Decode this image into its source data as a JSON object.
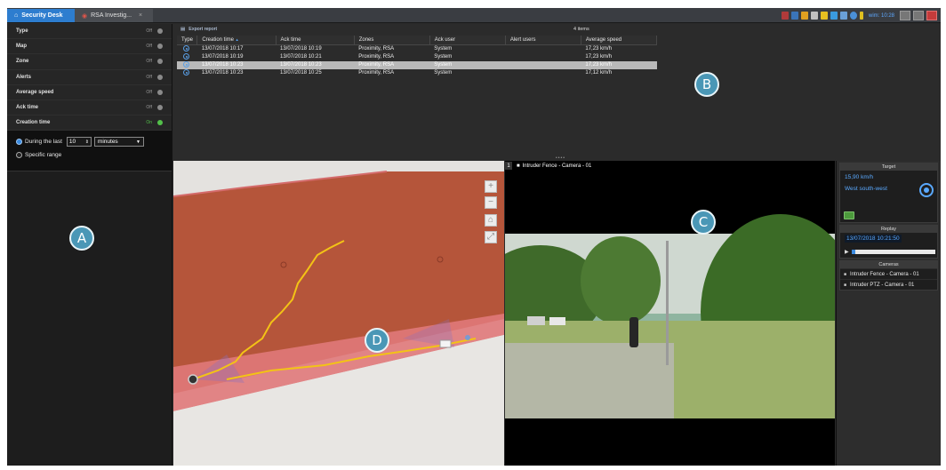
{
  "tabs": [
    {
      "label": "Security Desk",
      "icon": "home-icon"
    },
    {
      "label": "RSA Investig...",
      "icon": "rsa-icon",
      "close": "×"
    }
  ],
  "tray": {
    "clock": "wim: 10:28"
  },
  "filters": [
    {
      "label": "Type",
      "state": "Off"
    },
    {
      "label": "Map",
      "state": "Off"
    },
    {
      "label": "Zone",
      "state": "Off"
    },
    {
      "label": "Alerts",
      "state": "Off"
    },
    {
      "label": "Average speed",
      "state": "Off"
    },
    {
      "label": "Ack time",
      "state": "Off"
    },
    {
      "label": "Creation time",
      "state": "On"
    }
  ],
  "creation_time": {
    "during_label": "During the last",
    "value": "10",
    "unit": "minutes",
    "specific_label": "Specific range"
  },
  "report": {
    "export_label": "Export report",
    "item_count": "4 items",
    "columns": [
      "Type",
      "Creation time",
      "Ack time",
      "Zones",
      "Ack user",
      "Alert users",
      "Average speed"
    ],
    "sort_indicator": "▲",
    "rows": [
      {
        "creation": "13/07/2018 10:17",
        "ack": "13/07/2018 10:19",
        "zones": "Proximity, RSA",
        "ack_user": "System",
        "alert_users": "",
        "speed": "17,23 km/h"
      },
      {
        "creation": "13/07/2018 10:19",
        "ack": "13/07/2018 10:21",
        "zones": "Proximity, RSA",
        "ack_user": "System",
        "alert_users": "",
        "speed": "17,23 km/h"
      },
      {
        "creation": "13/07/2018 10:23",
        "ack": "13/07/2018 10:23",
        "zones": "Proximity, RSA",
        "ack_user": "System",
        "alert_users": "",
        "speed": "17,23 km/h"
      },
      {
        "creation": "13/07/2018 10:23",
        "ack": "13/07/2018 10:25",
        "zones": "Proximity, RSA",
        "ack_user": "System",
        "alert_users": "",
        "speed": "17,12 km/h"
      }
    ],
    "selected_row": 2
  },
  "map": {
    "controls": [
      "+",
      "−",
      "⌂",
      "⤢"
    ]
  },
  "video": {
    "tile_number": "1",
    "title": "Intruder Fence - Camera - 01"
  },
  "side": {
    "target_header": "Target",
    "speed": "15,90 km/h",
    "direction": "West south-west",
    "replay_header": "Replay",
    "replay_time": "13/07/2018 10:21:50",
    "replay_progress": 0.05,
    "cameras_header": "Cameras",
    "cameras": [
      "Intruder Fence - Camera - 01",
      "Intruder PTZ - Camera - 01"
    ]
  },
  "callouts": [
    "A",
    "B",
    "C",
    "D"
  ],
  "colors": {
    "accent": "#2d7dcf",
    "zone_fill": "#b5553a",
    "track": "#f3c316",
    "callout": "#4a97b6"
  }
}
